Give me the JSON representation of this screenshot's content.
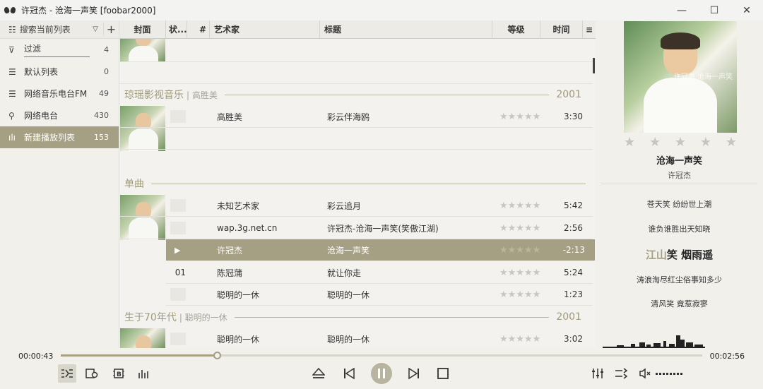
{
  "window": {
    "title": "许冠杰 - 沧海一声笑  [foobar2000]",
    "minimize": "—",
    "maximize": "☐",
    "close": "✕"
  },
  "sidebar": {
    "search_label": "搜索当前列表",
    "items": [
      {
        "label": "过滤",
        "count": "4"
      },
      {
        "label": "默认列表",
        "count": "0"
      },
      {
        "label": "网络音乐电台FM",
        "count": "49"
      },
      {
        "label": "网络电台",
        "count": "430"
      },
      {
        "label": "新建播放列表",
        "count": "153"
      }
    ]
  },
  "playlist": {
    "columns": {
      "cover": "封面",
      "status": "状...",
      "num": "#",
      "artist": "艺术家",
      "title": "标题",
      "rating": "等级",
      "time": "时间"
    },
    "groups": [
      {
        "name": "琼瑶影视音乐",
        "sub": "| 高胜美",
        "year": "2001"
      },
      {
        "name": "单曲",
        "sub": "",
        "year": ""
      },
      {
        "name": "生于70年代",
        "sub": "| 聪明的一休",
        "year": "2001"
      }
    ],
    "rows": [
      {
        "num": "",
        "artist": "高胜美",
        "title": "彩云伴海鸥",
        "time": "3:30"
      },
      {
        "num": "",
        "artist": "未知艺术家",
        "title": "彩云追月",
        "time": "5:42"
      },
      {
        "num": "",
        "artist": "wap.3g.net.cn",
        "title": "许冠杰-沧海一声笑(笑傲江湖)",
        "time": "2:56"
      },
      {
        "num": "",
        "artist": "许冠杰",
        "title": "沧海一声笑",
        "time": "-2:13"
      },
      {
        "num": "01",
        "artist": "陈冠蒲",
        "title": "就让你走",
        "time": "5:24"
      },
      {
        "num": "",
        "artist": "聪明的一休",
        "title": "聪明的一休",
        "time": "1:23"
      },
      {
        "num": "",
        "artist": "聪明的一休",
        "title": "聪明的一休",
        "time": "3:02"
      }
    ],
    "stars": "★★★★★"
  },
  "now_playing": {
    "title": "沧海一声笑",
    "artist": "许冠杰",
    "cover_caption": "许冠杰 沧海一声笑",
    "lyrics": [
      "苍天笑 纷纷世上潮",
      "谁负谁胜出天知晓",
      "笑 烟雨遥",
      "涛浪淘尽红尘俗事知多少",
      "清风笑 竟惹寂寥"
    ],
    "lyric_sung": "江山"
  },
  "transport": {
    "elapsed": "00:00:43",
    "total": "00:02:56",
    "progress": 0.245
  },
  "colors": {
    "accent": "#a59f83"
  }
}
